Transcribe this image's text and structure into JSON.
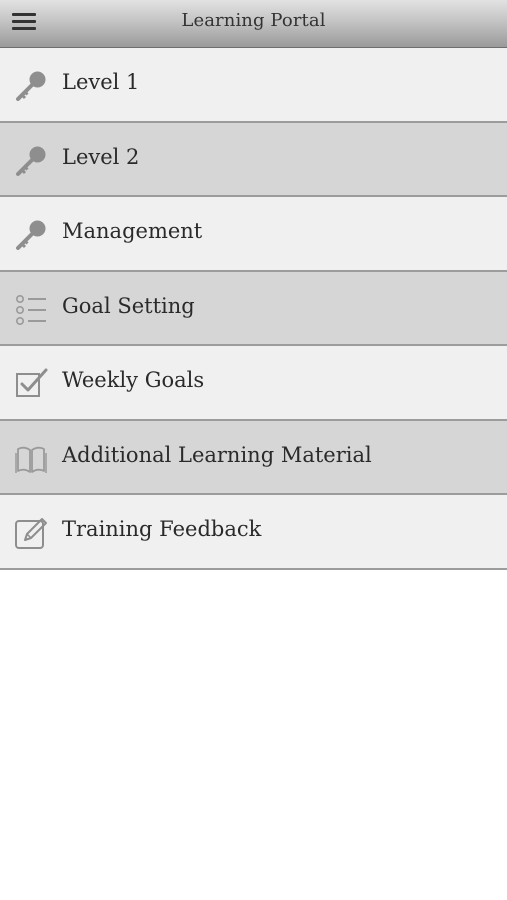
{
  "header": {
    "menu_icon": "hamburger-menu-icon",
    "title": "Learning Portal"
  },
  "colors": {
    "row_light": "#f0f0f0",
    "row_dark": "#d6d6d6",
    "divider": "#9c9c9c",
    "icon": "#8e8e8e"
  },
  "menu": {
    "items": [
      {
        "label": "Level 1",
        "icon": "key-icon"
      },
      {
        "label": "Level 2",
        "icon": "key-icon"
      },
      {
        "label": "Management",
        "icon": "key-icon"
      },
      {
        "label": "Goal Setting",
        "icon": "checklist-icon"
      },
      {
        "label": "Weekly Goals",
        "icon": "checkbox-checked-icon"
      },
      {
        "label": "Additional Learning Material",
        "icon": "open-book-icon"
      },
      {
        "label": "Training Feedback",
        "icon": "edit-pencil-icon"
      }
    ]
  }
}
